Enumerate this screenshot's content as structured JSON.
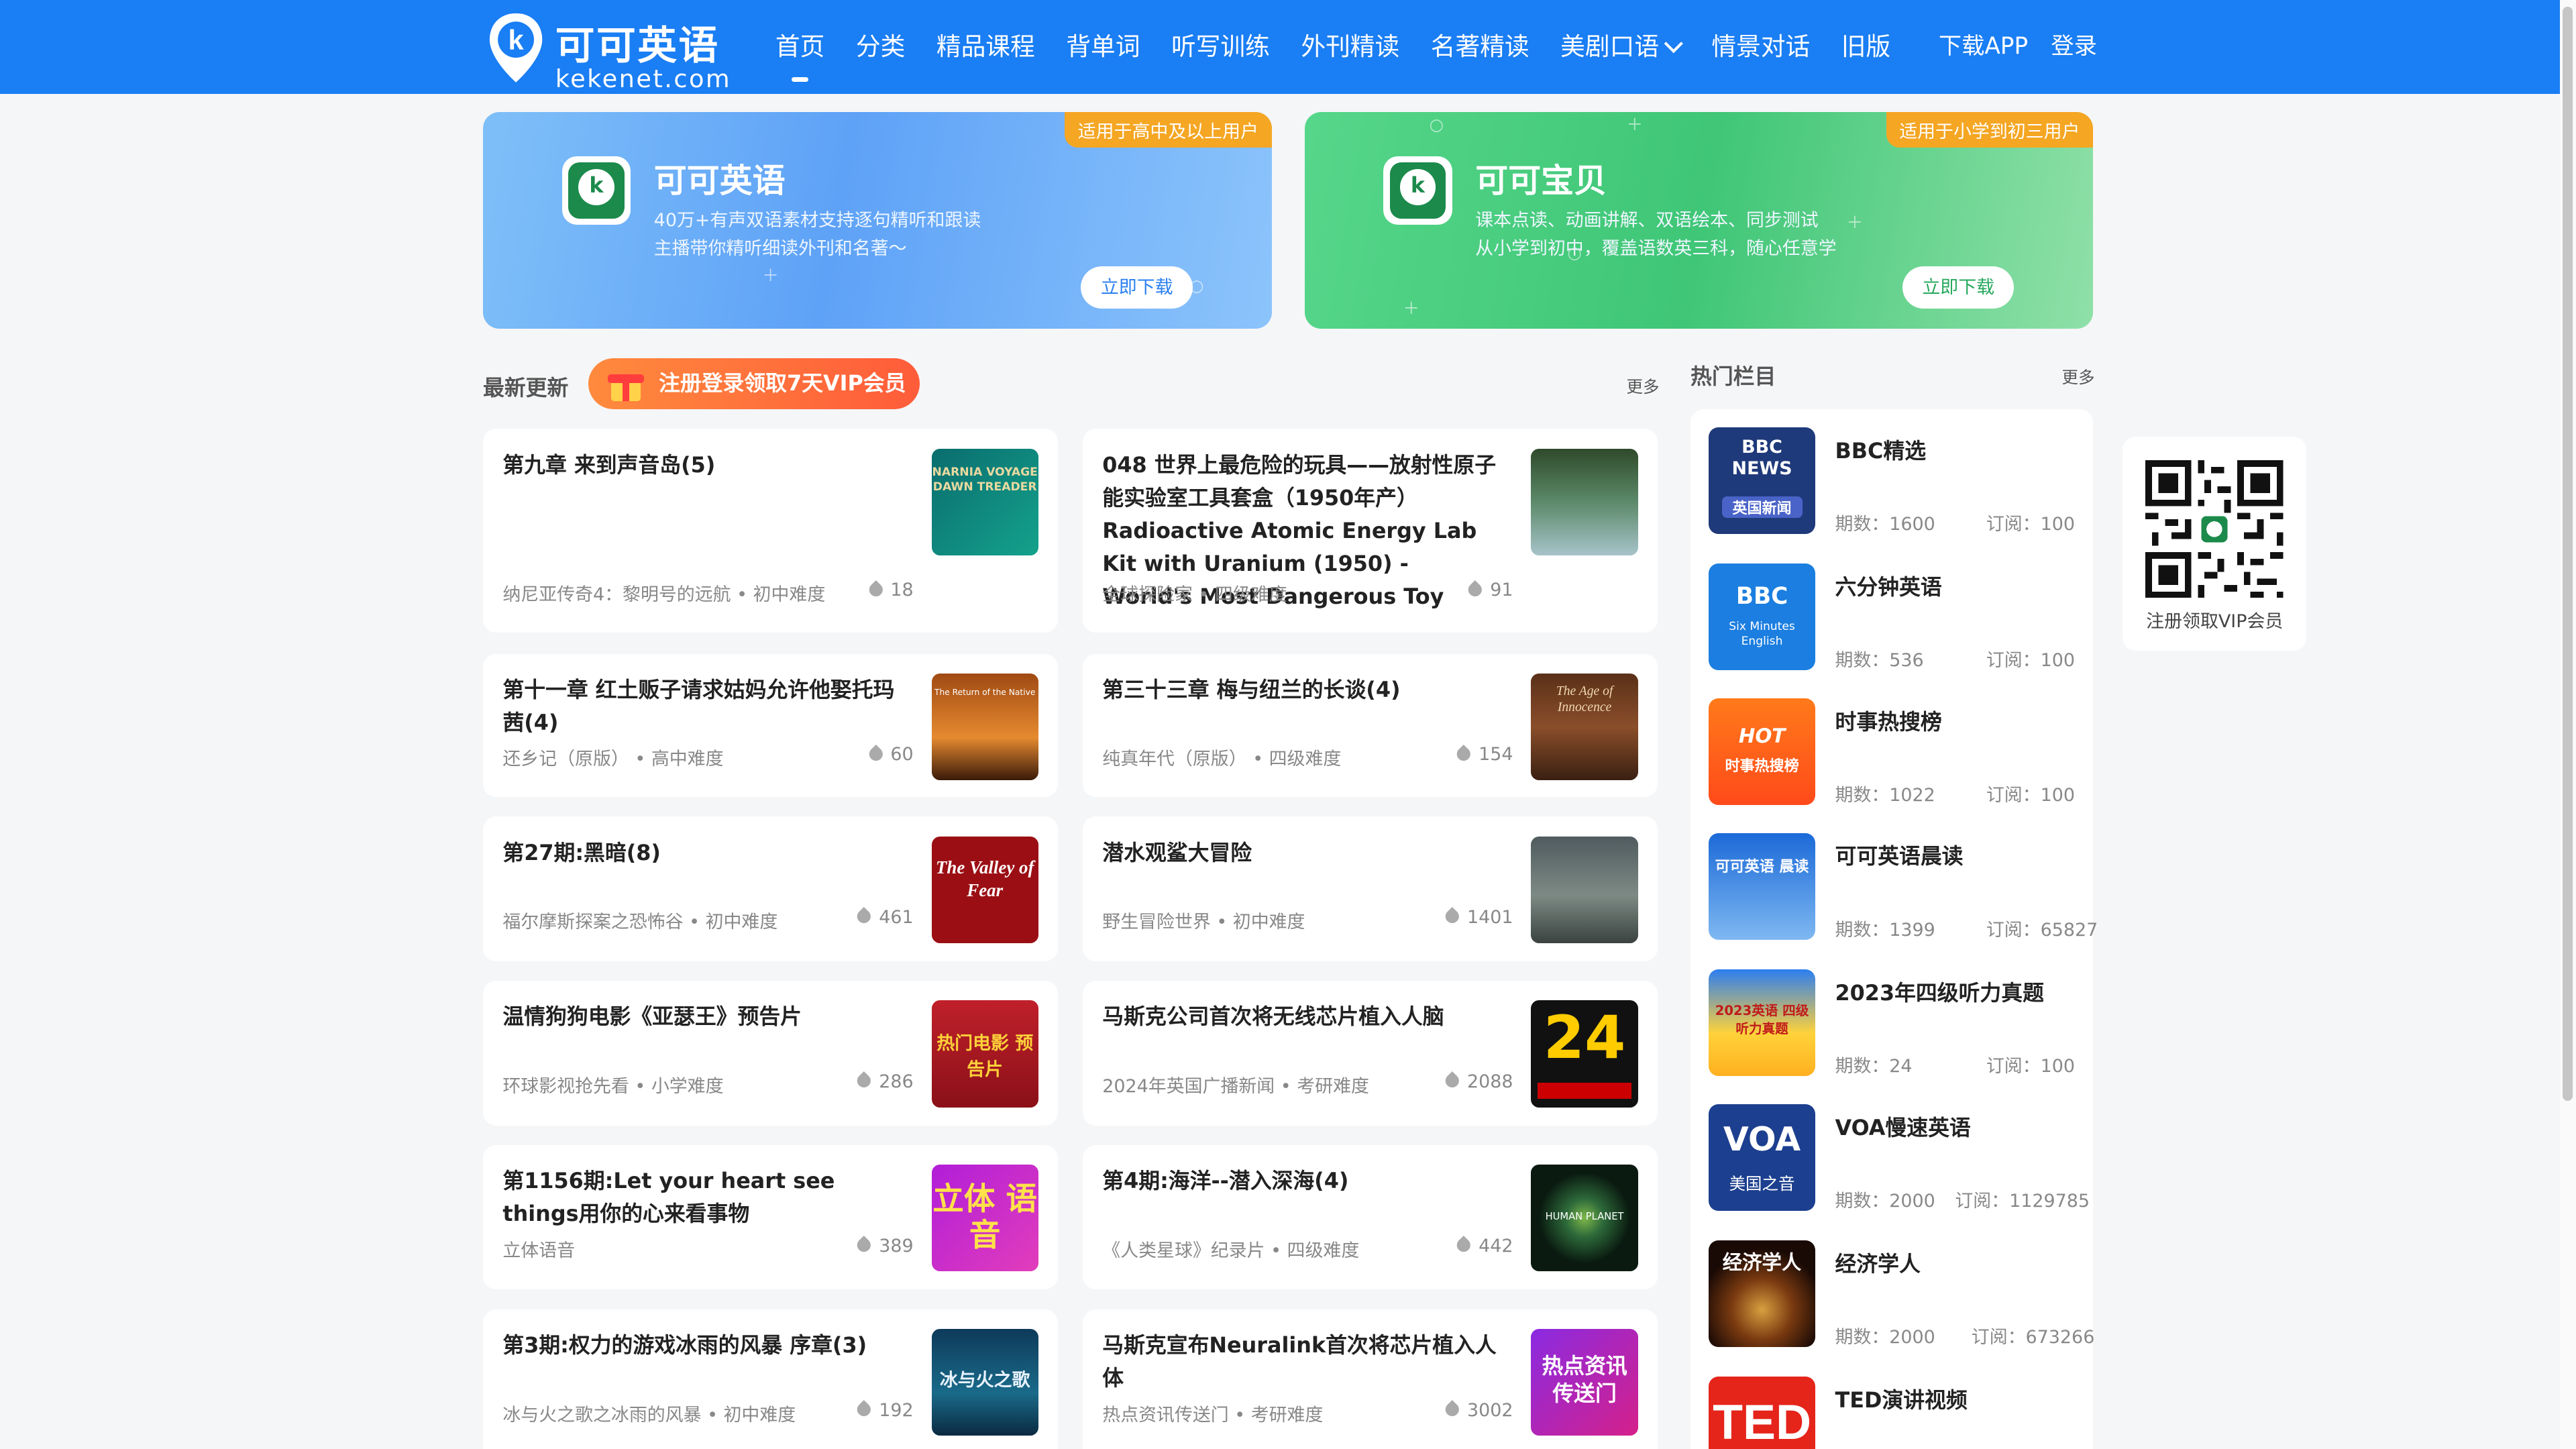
{
  "nav": {
    "logo_title": "可可英语",
    "logo_sub": "kekenet.com",
    "items": [
      "首页",
      "分类",
      "精品课程",
      "背单词",
      "听写训练",
      "外刊精读",
      "名著精读",
      "美剧口语",
      "情景对话",
      "旧版"
    ],
    "download": "下载APP",
    "login": "登录"
  },
  "banners": [
    {
      "tag": "适用于高中及以上用户",
      "title": "可可英语",
      "line1": "40万+有声双语素材支持逐句精听和跟读",
      "line2": "主播带你精听细读外刊和名著～",
      "button": "立即下载"
    },
    {
      "tag": "适用于小学到初三用户",
      "title": "可可宝贝",
      "line1": "课本点读、动画讲解、双语绘本、同步测试",
      "line2": "从小学到初中，覆盖语数英三科，随心任意学",
      "button": "立即下载"
    }
  ],
  "latest": {
    "title": "最新更新",
    "vip": "注册登录领取7天VIP会员",
    "more": "更多",
    "cards": [
      {
        "title": "第九章 来到声音岛(5)",
        "meta": "纳尼亚传奇4：黎明号的远航 • 初中难度",
        "count": "18",
        "thumb": "NARNIA VOYAGE DAWN TREADER"
      },
      {
        "title": "048 世界上最危险的玩具——放射性原子能实验室工具套盒（1950年产）Radioactive Atomic Energy Lab Kit with Uranium (1950) - World's Most Dangerous Toy",
        "meta": "全球探险家 • 四级难度",
        "count": "91",
        "thumb": ""
      },
      {
        "title": "第十一章 红土贩子请求姑妈允许他娶托玛茜(4)",
        "meta": "还乡记（原版） • 高中难度",
        "count": "60",
        "thumb": "The Return of the Native"
      },
      {
        "title": "第三十三章 梅与纽兰的长谈(4)",
        "meta": "纯真年代（原版） • 四级难度",
        "count": "154",
        "thumb": "The Age of Innocence"
      },
      {
        "title": "第27期:黑暗(8)",
        "meta": "福尔摩斯探案之恐怖谷 • 初中难度",
        "count": "461",
        "thumb": "The Valley of Fear"
      },
      {
        "title": "潜水观鲨大冒险",
        "meta": "野生冒险世界 • 初中难度",
        "count": "1401",
        "thumb": ""
      },
      {
        "title": "温情狗狗电影《亚瑟王》预告片",
        "meta": "环球影视抢先看 • 小学难度",
        "count": "286",
        "thumb": "热门电影 预告片"
      },
      {
        "title": "马斯克公司首次将无线芯片植入人脑",
        "meta": "2024年英国广播新闻 • 考研难度",
        "count": "2088",
        "thumb": "24"
      },
      {
        "title": "第1156期:Let your heart see things用你的心来看事物",
        "meta": "立体语音",
        "count": "389",
        "thumb": "立体 语音"
      },
      {
        "title": "第4期:海洋--潜入深海(4)",
        "meta": "《人类星球》纪录片 • 四级难度",
        "count": "442",
        "thumb": "HUMAN PLANET"
      },
      {
        "title": "第3期:权力的游戏冰雨的风暴 序章(3)",
        "meta": "冰与火之歌之冰雨的风暴 • 初中难度",
        "count": "192",
        "thumb": "冰与火之歌"
      },
      {
        "title": "马斯克宣布Neuralink首次将芯片植入人体",
        "meta": "热点资讯传送门 • 考研难度",
        "count": "3002",
        "thumb": "热点资讯 传送门"
      }
    ]
  },
  "hot": {
    "title": "热门栏目",
    "more": "更多",
    "items": [
      {
        "name": "BBC精选",
        "issues": "期数：1600",
        "subs": "订阅：100",
        "icon_text": "BBC NEWS",
        "icon_sub": "英国新闻"
      },
      {
        "name": "六分钟英语",
        "issues": "期数：536",
        "subs": "订阅：100",
        "icon_text": "BBC",
        "icon_sub": "Six Minutes English"
      },
      {
        "name": "时事热搜榜",
        "issues": "期数：1022",
        "subs": "订阅：100",
        "icon_text": "HOT",
        "icon_sub": "时事热搜榜"
      },
      {
        "name": "可可英语晨读",
        "issues": "期数：1399",
        "subs": "订阅：65827",
        "icon_text": "可可英语 晨读",
        "icon_sub": ""
      },
      {
        "name": "2023年四级听力真题",
        "issues": "期数：24",
        "subs": "订阅：100",
        "icon_text": "2023英语 四级听力真题",
        "icon_sub": ""
      },
      {
        "name": "VOA慢速英语",
        "issues": "期数：2000",
        "subs": "订阅：1129785",
        "icon_text": "VOA",
        "icon_sub": "美国之音"
      },
      {
        "name": "经济学人",
        "issues": "期数：2000",
        "subs": "订阅：673266",
        "icon_text": "经济学人",
        "icon_sub": ""
      },
      {
        "name": "TED演讲视频",
        "issues": "",
        "subs": "",
        "icon_text": "TED",
        "icon_sub": ""
      }
    ]
  },
  "qr": {
    "label": "注册领取VIP会员"
  },
  "colors": {
    "nav": "#1a7ef4",
    "accent_orange": "#f5a623",
    "vip_pill": "#ff6a3b"
  }
}
